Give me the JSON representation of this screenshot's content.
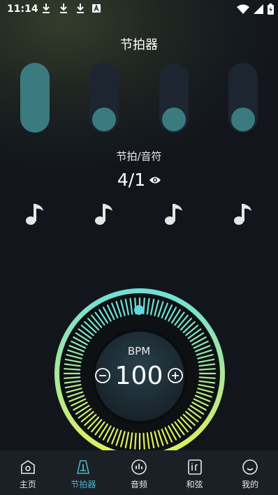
{
  "status_bar": {
    "time": "11:14",
    "left_icons": [
      "download-icon",
      "download-icon",
      "download-icon",
      "a-icon"
    ],
    "right_icons": [
      "wifi-icon",
      "cellular-icon",
      "battery-icon"
    ]
  },
  "header": {
    "title": "节拍器"
  },
  "beats": {
    "count": 4,
    "active_index": 0,
    "active_color": "#3b7a7e",
    "track_color": "#1d2530"
  },
  "time_signature": {
    "label": "节拍/音符",
    "value": "4/1",
    "icon": "eye-icon"
  },
  "notes": {
    "icon": "music-note-icon",
    "count": 4
  },
  "metronome": {
    "label": "BPM",
    "value": "100",
    "decrease_icon": "minus-circle-icon",
    "increase_icon": "plus-circle-icon",
    "colors": {
      "ring_top": "#6ee0d8",
      "ring_bottom": "#e3f05a",
      "inner": "#1f2f38"
    }
  },
  "nav": {
    "active_index": 1,
    "active_color": "#4db6c9",
    "items": [
      {
        "label": "主页",
        "icon": "home-icon"
      },
      {
        "label": "节拍器",
        "icon": "metronome-icon"
      },
      {
        "label": "音频",
        "icon": "audio-icon"
      },
      {
        "label": "和弦",
        "icon": "chord-icon"
      },
      {
        "label": "我的",
        "icon": "profile-icon"
      }
    ]
  }
}
